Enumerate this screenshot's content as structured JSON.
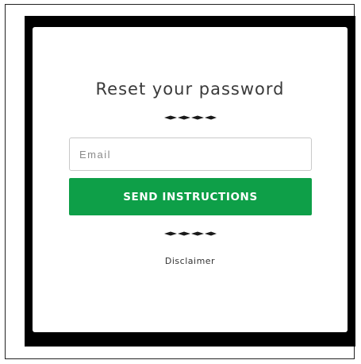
{
  "reset_form": {
    "title": "Reset your password",
    "email_placeholder": "Email",
    "email_value": "",
    "submit_label": "SEND INSTRUCTIONS",
    "disclaimer_link": "Disclaimer"
  },
  "icons": {
    "divider": "diamond-divider-icon"
  },
  "colors": {
    "button_background": "#0e9f48",
    "button_text": "#ffffff",
    "backdrop": "#000000",
    "card_background": "#ffffff"
  }
}
